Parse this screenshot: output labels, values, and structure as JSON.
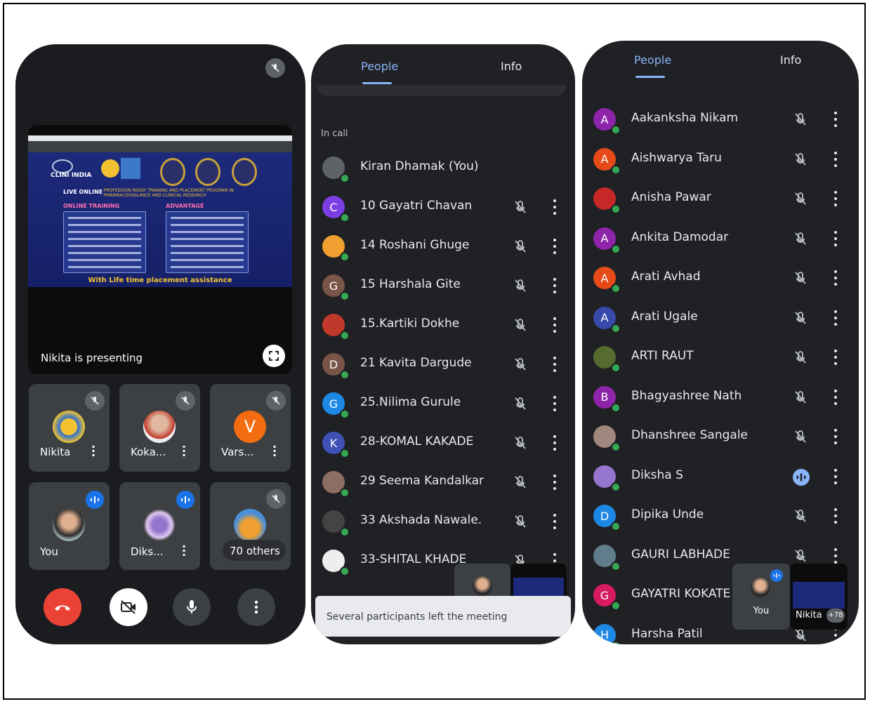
{
  "phone1": {
    "presenting_label": "Nikita is presenting",
    "slide": {
      "brand": "CLINI INDIA",
      "live_online": "LIVE ONLINE",
      "program": "PROFESSION READY TRAINING AND PLACEMENT PROGRAM IN PHARMACOVIGILANCE AND CLINICAL RESEARCH",
      "online_training": "ONLINE TRAINING",
      "advantage": "ADVANTAGE",
      "footer": "With Life time placement assistance"
    },
    "tiles": [
      {
        "name": "Nikita"
      },
      {
        "name": "Koka..."
      },
      {
        "name": "Vars...",
        "initial": "V"
      },
      {
        "name": "You"
      },
      {
        "name": "Diks..."
      },
      {
        "name": "70 others"
      }
    ]
  },
  "phone2": {
    "tab_people": "People",
    "tab_info": "Info",
    "section_label": "In call",
    "participants": [
      {
        "name": "Kiran Dhamak (You)",
        "initial": "",
        "color": "#5f6368"
      },
      {
        "name": "10 Gayatri Chavan",
        "initial": "C",
        "color": "#7b3fe4"
      },
      {
        "name": "14 Roshani Ghuge",
        "initial": "",
        "color": "#f0a030"
      },
      {
        "name": "15 Harshala Gite",
        "initial": "G",
        "color": "#795548"
      },
      {
        "name": "15.Kartiki Dokhe",
        "initial": "",
        "color": "#c0392b"
      },
      {
        "name": "21 Kavita Dargude",
        "initial": "D",
        "color": "#795548"
      },
      {
        "name": "25.Nilima Gurule",
        "initial": "G",
        "color": "#1e88e5"
      },
      {
        "name": "28-KOMAL KAKADE",
        "initial": "K",
        "color": "#3f51b5"
      },
      {
        "name": "29 Seema Kandalkar",
        "initial": "",
        "color": "#8d6e63"
      },
      {
        "name": "33 Akshada Nawale.",
        "initial": "",
        "color": "#444"
      },
      {
        "name": "33-SHITAL KHADE",
        "initial": "",
        "color": "#eee"
      }
    ],
    "toast": "Several participants left the meeting"
  },
  "phone3": {
    "tab_people": "People",
    "tab_info": "Info",
    "participants": [
      {
        "name": "Aakanksha Nikam",
        "initial": "A",
        "color": "#8e24aa",
        "speaking": false
      },
      {
        "name": "Aishwarya Taru",
        "initial": "A",
        "color": "#e64a19",
        "speaking": false
      },
      {
        "name": "Anisha Pawar",
        "initial": "",
        "color": "#c62828",
        "speaking": false
      },
      {
        "name": "Ankita Damodar",
        "initial": "A",
        "color": "#8e24aa",
        "speaking": false
      },
      {
        "name": "Arati Avhad",
        "initial": "A",
        "color": "#e64a19",
        "speaking": false
      },
      {
        "name": "Arati Ugale",
        "initial": "A",
        "color": "#3949ab",
        "speaking": false
      },
      {
        "name": "ARTI RAUT",
        "initial": "",
        "color": "#556b2f",
        "speaking": false
      },
      {
        "name": "Bhagyashree Nath",
        "initial": "B",
        "color": "#8e24aa",
        "speaking": false
      },
      {
        "name": "Dhanshree Sangale",
        "initial": "",
        "color": "#a1887f",
        "speaking": false
      },
      {
        "name": "Diksha S",
        "initial": "",
        "color": "#9575cd",
        "speaking": true
      },
      {
        "name": "Dipika Unde",
        "initial": "D",
        "color": "#1e88e5",
        "speaking": false
      },
      {
        "name": "GAURI LABHADE",
        "initial": "",
        "color": "#607d8b",
        "speaking": false
      },
      {
        "name": "GAYATRI KOKATE",
        "initial": "G",
        "color": "#d81b60",
        "speaking": false
      },
      {
        "name": "Harsha Patil",
        "initial": "H",
        "color": "#1e88e5",
        "speaking": false
      }
    ],
    "pip_you": "You",
    "pip_nikita": "Nikita",
    "pip_count": "+78"
  }
}
